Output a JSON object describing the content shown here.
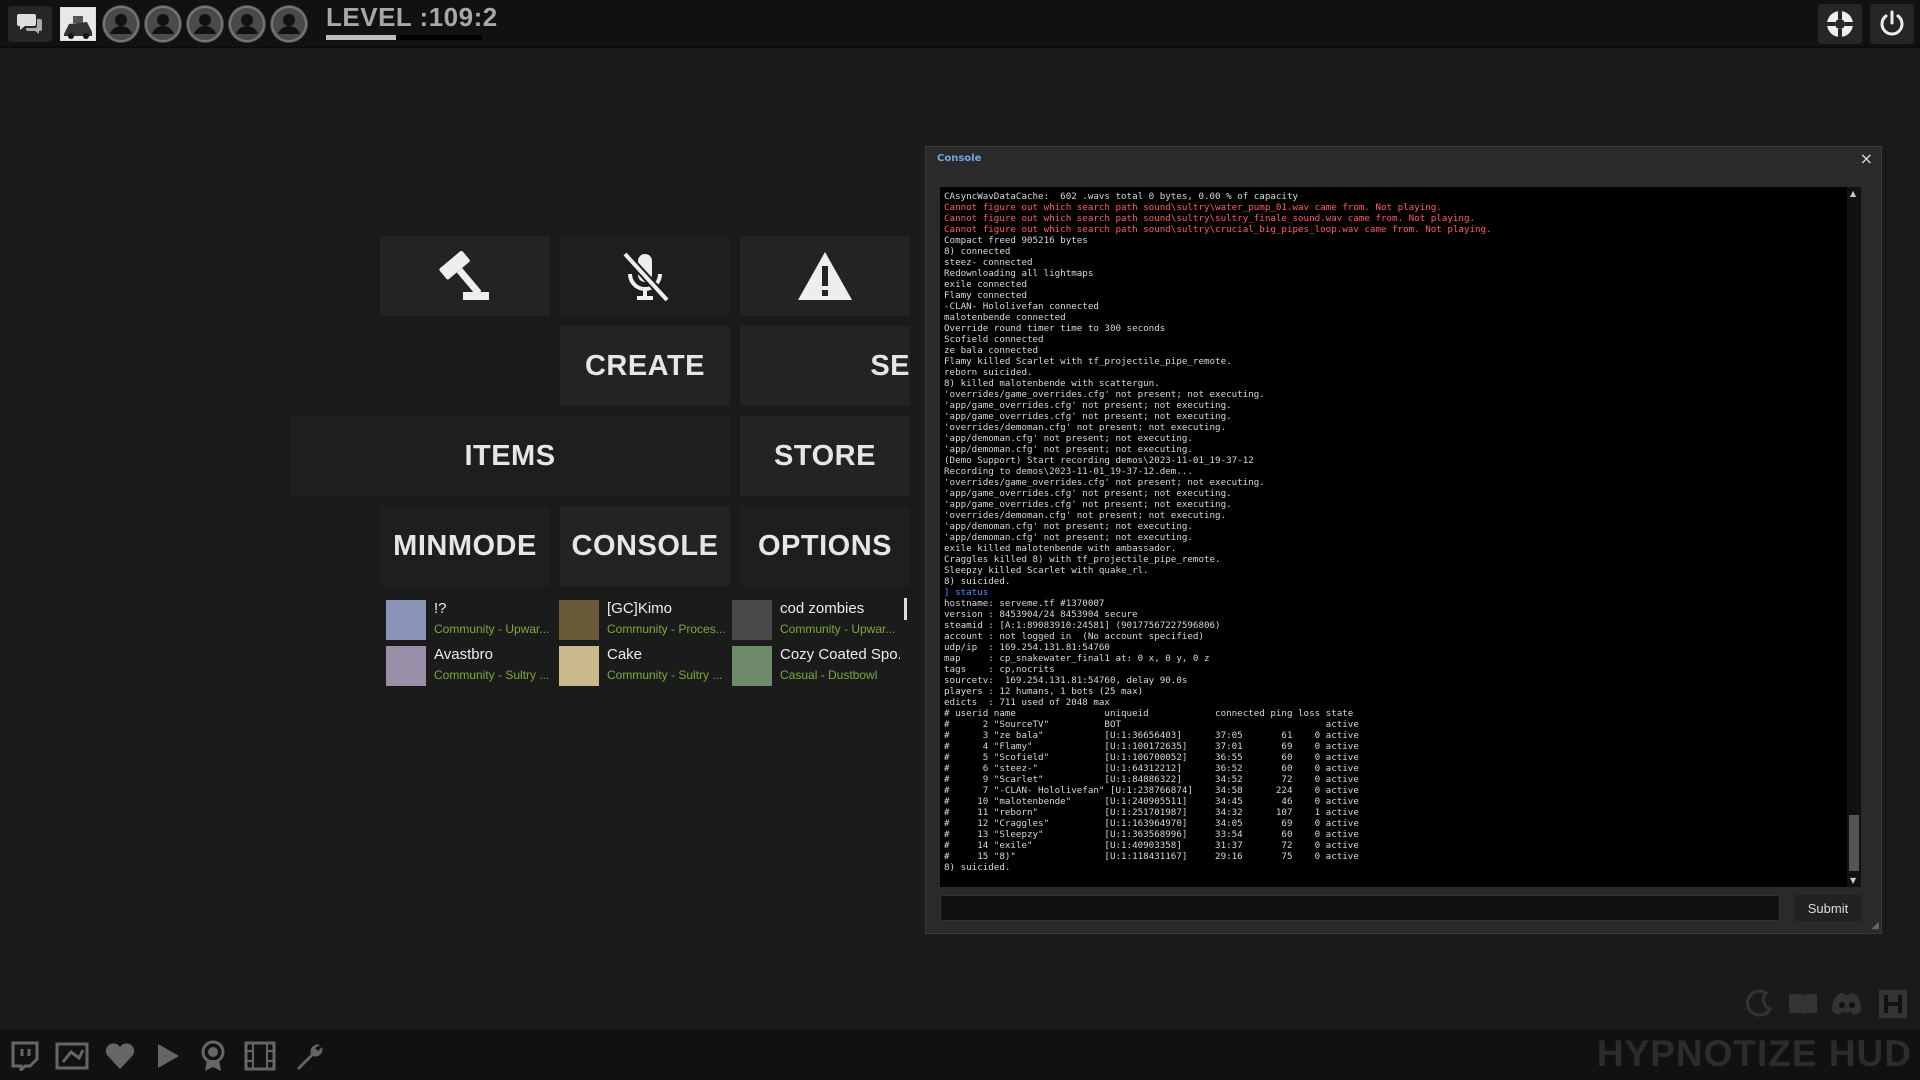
{
  "top_bar": {
    "level": "LEVEL :109:2",
    "level_progress": 0.45,
    "party_slots": 5
  },
  "menu": {
    "create": "CREATE",
    "servers_cut": "SE",
    "items": "ITEMS",
    "store": "STORE",
    "minmode": "MINMODE",
    "console": "CONSOLE",
    "options": "OPTIONS"
  },
  "servers": [
    {
      "name": "!?",
      "category": "Community - Upwar...",
      "thumb_color": "#8a94b8"
    },
    {
      "name": "[GC]Kimo",
      "category": "Community - Proces...",
      "thumb_color": "#6b5a3a"
    },
    {
      "name": "cod zombies",
      "category": "Community - Upwar...",
      "thumb_color": "#4a4a4a"
    },
    {
      "name": "Avastbro",
      "category": "Community - Sultry ...",
      "thumb_color": "#9a8fa8"
    },
    {
      "name": "Cake",
      "category": "Community - Sultry ...",
      "thumb_color": "#c9b98a"
    },
    {
      "name": "Cozy Coated Spo...",
      "category": "Casual - Dustbowl",
      "thumb_color": "#6f8a6a"
    }
  ],
  "console": {
    "title": "Console",
    "close": "×",
    "submit": "Submit",
    "lines": [
      {
        "t": "CAsyncWavDataCache:  602 .wavs total 0 bytes, 0.00 % of capacity",
        "k": ""
      },
      {
        "t": "Cannot figure out which search path sound\\sultry\\water_pump_01.wav came from. Not playing.",
        "k": "err"
      },
      {
        "t": "Cannot figure out which search path sound\\sultry\\sultry_finale_sound.wav came from. Not playing.",
        "k": "err"
      },
      {
        "t": "Cannot figure out which search path sound\\sultry\\crucial_big_pipes_loop.wav came from. Not playing.",
        "k": "err"
      },
      {
        "t": "Compact freed 905216 bytes",
        "k": ""
      },
      {
        "t": "8) connected",
        "k": ""
      },
      {
        "t": "steez- connected",
        "k": ""
      },
      {
        "t": "Redownloading all lightmaps",
        "k": ""
      },
      {
        "t": "exile connected",
        "k": ""
      },
      {
        "t": "Flamy connected",
        "k": ""
      },
      {
        "t": "-CLAN- Hololivefan connected",
        "k": ""
      },
      {
        "t": "malotenbende connected",
        "k": ""
      },
      {
        "t": "Override round timer time to 300 seconds",
        "k": ""
      },
      {
        "t": "Scofield connected",
        "k": ""
      },
      {
        "t": "ze bala connected",
        "k": ""
      },
      {
        "t": "Flamy killed Scarlet with tf_projectile_pipe_remote.",
        "k": ""
      },
      {
        "t": "reborn suicided.",
        "k": ""
      },
      {
        "t": "8) killed malotenbende with scattergun.",
        "k": ""
      },
      {
        "t": "'overrides/game_overrides.cfg' not present; not executing.",
        "k": ""
      },
      {
        "t": "'app/game_overrides.cfg' not present; not executing.",
        "k": ""
      },
      {
        "t": "'app/game_overrides.cfg' not present; not executing.",
        "k": ""
      },
      {
        "t": "'overrides/demoman.cfg' not present; not executing.",
        "k": ""
      },
      {
        "t": "'app/demoman.cfg' not present; not executing.",
        "k": ""
      },
      {
        "t": "'app/demoman.cfg' not present; not executing.",
        "k": ""
      },
      {
        "t": "(Demo Support) Start recording demos\\2023-11-01_19-37-12",
        "k": ""
      },
      {
        "t": "Recording to demos\\2023-11-01_19-37-12.dem...",
        "k": ""
      },
      {
        "t": "'overrides/game_overrides.cfg' not present; not executing.",
        "k": ""
      },
      {
        "t": "'app/game_overrides.cfg' not present; not executing.",
        "k": ""
      },
      {
        "t": "'app/game_overrides.cfg' not present; not executing.",
        "k": ""
      },
      {
        "t": "'overrides/demoman.cfg' not present; not executing.",
        "k": ""
      },
      {
        "t": "'app/demoman.cfg' not present; not executing.",
        "k": ""
      },
      {
        "t": "'app/demoman.cfg' not present; not executing.",
        "k": ""
      },
      {
        "t": "exile killed malotenbende with ambassador.",
        "k": ""
      },
      {
        "t": "Craggles killed 8) with tf_projectile_pipe_remote.",
        "k": ""
      },
      {
        "t": "Sleepzy killed Scarlet with quake_rl.",
        "k": ""
      },
      {
        "t": "8) suicided.",
        "k": ""
      },
      {
        "t": "] status",
        "k": "cmd"
      },
      {
        "t": "hostname: serveme.tf #1370007",
        "k": ""
      },
      {
        "t": "version : 8453904/24 8453904 secure",
        "k": ""
      },
      {
        "t": "steamid : [A:1:89083910:24581] (90177567227596806)",
        "k": ""
      },
      {
        "t": "account : not logged in  (No account specified)",
        "k": ""
      },
      {
        "t": "udp/ip  : 169.254.131.81:54760",
        "k": ""
      },
      {
        "t": "map     : cp_snakewater_final1 at: 0 x, 0 y, 0 z",
        "k": ""
      },
      {
        "t": "tags    : cp,nocrits",
        "k": ""
      },
      {
        "t": "sourcetv:  169.254.131.81:54760, delay 90.0s",
        "k": ""
      },
      {
        "t": "players : 12 humans, 1 bots (25 max)",
        "k": ""
      },
      {
        "t": "edicts  : 711 used of 2048 max",
        "k": ""
      },
      {
        "t": "# userid name                uniqueid            connected ping loss state",
        "k": ""
      },
      {
        "t": "#      2 \"SourceTV\"          BOT                                     active",
        "k": ""
      },
      {
        "t": "#      3 \"ze bala\"           [U:1:36656403]      37:05       61    0 active",
        "k": ""
      },
      {
        "t": "#      4 \"Flamy\"             [U:1:100172635]     37:01       69    0 active",
        "k": ""
      },
      {
        "t": "#      5 \"Scofield\"          [U:1:106700052]     36:55       60    0 active",
        "k": ""
      },
      {
        "t": "#      6 \"steez-\"            [U:1:64312212]      36:52       60    0 active",
        "k": ""
      },
      {
        "t": "#      9 \"Scarlet\"           [U:1:84886322]      34:52       72    0 active",
        "k": ""
      },
      {
        "t": "#      7 \"-CLAN- Hololivefan\" [U:1:238766874]    34:58      224    0 active",
        "k": ""
      },
      {
        "t": "#     10 \"malotenbende\"      [U:1:240905511]     34:45       46    0 active",
        "k": ""
      },
      {
        "t": "#     11 \"reborn\"            [U:1:251701987]     34:32      107    1 active",
        "k": ""
      },
      {
        "t": "#     12 \"Craggles\"          [U:1:163964970]     34:05       69    0 active",
        "k": ""
      },
      {
        "t": "#     13 \"Sleepzy\"           [U:1:363568996]     33:54       60    0 active",
        "k": ""
      },
      {
        "t": "#     14 \"exile\"             [U:1:40903358]      31:37       72    0 active",
        "k": ""
      },
      {
        "t": "#     15 \"8)\"                [U:1:118431167]     29:16       75    0 active",
        "k": ""
      },
      {
        "t": "8) suicided.",
        "k": ""
      }
    ]
  },
  "brand": "HYPNOTIZE HUD",
  "icons": {
    "chat": "chat-icon",
    "avatar": "avatar-image",
    "party": "party-member-icon",
    "tf2": "tf2-logo-icon",
    "quit": "power-icon",
    "hammer": "hammer-icon",
    "mute": "mic-mute-icon",
    "warning": "warning-icon",
    "bottom": [
      "twitch-icon",
      "connections-icon",
      "heart-icon",
      "play-icon",
      "achievement-icon",
      "film-icon",
      "wrench-icon"
    ],
    "bottom_right": [
      "moon-icon",
      "book-icon",
      "discord-icon",
      "hypnotize-icon"
    ]
  }
}
